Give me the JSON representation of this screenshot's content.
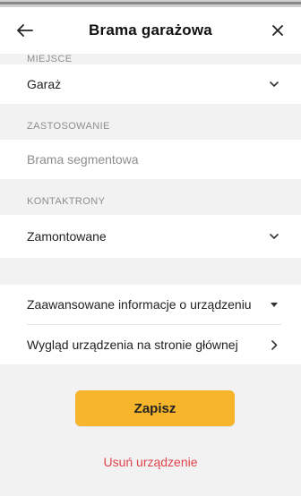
{
  "header": {
    "title": "Brama garażowa",
    "back_icon": "arrow-left-icon",
    "close_icon": "close-icon"
  },
  "sections": {
    "place": {
      "label": "MIEJSCE",
      "value": "Garaż"
    },
    "usage": {
      "label": "ZASTOSOWANIE",
      "placeholder": "Brama segmentowa"
    },
    "contacts": {
      "label": "KONTAKTRONY",
      "value": "Zamontowane"
    }
  },
  "list": {
    "advanced_info": "Zaawansowane informacje o urządzeniu",
    "home_appearance": "Wygląd urządzenia na stronie głównej"
  },
  "actions": {
    "save": "Zapisz",
    "delete": "Usuń urządzenie"
  },
  "colors": {
    "accent": "#f7b52b",
    "danger": "#e0434b",
    "background": "#f2f2f2"
  }
}
